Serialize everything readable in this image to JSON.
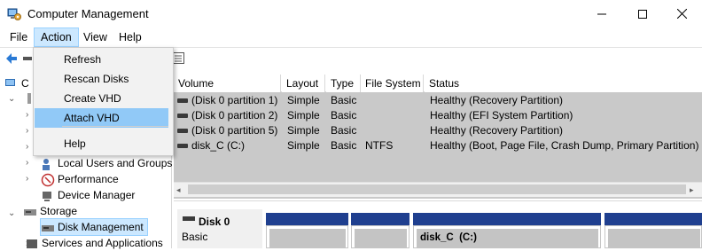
{
  "window": {
    "title": "Computer Management",
    "controls": {
      "minimize_icon": "minimize-icon",
      "maximize_icon": "maximize-icon",
      "close_icon": "close-icon"
    }
  },
  "menubar": {
    "items": [
      {
        "label": "File"
      },
      {
        "label": "Action"
      },
      {
        "label": "View"
      },
      {
        "label": "Help"
      }
    ],
    "open_menu": "Action"
  },
  "action_menu": {
    "items": [
      {
        "label": "Refresh"
      },
      {
        "label": "Rescan Disks"
      },
      {
        "label": "Create VHD"
      },
      {
        "label": "Attach VHD"
      },
      {
        "label": "Help"
      }
    ],
    "highlighted": "Attach VHD"
  },
  "tree": {
    "items": [
      {
        "label": "C"
      },
      {
        "label": "Local Users and Groups"
      },
      {
        "label": "Performance"
      },
      {
        "label": "Device Manager"
      },
      {
        "label": "Storage"
      },
      {
        "label": "Disk Management"
      },
      {
        "label": "Services and Applications"
      }
    ],
    "selected": "Disk Management"
  },
  "volume_table": {
    "columns": [
      "Volume",
      "Layout",
      "Type",
      "File System",
      "Status"
    ],
    "rows": [
      {
        "volume": "(Disk 0 partition 1)",
        "layout": "Simple",
        "type": "Basic",
        "fs": "",
        "status": "Healthy (Recovery Partition)"
      },
      {
        "volume": "(Disk 0 partition 2)",
        "layout": "Simple",
        "type": "Basic",
        "fs": "",
        "status": "Healthy (EFI System Partition)"
      },
      {
        "volume": "(Disk 0 partition 5)",
        "layout": "Simple",
        "type": "Basic",
        "fs": "",
        "status": "Healthy (Recovery Partition)"
      },
      {
        "volume": "disk_C (C:)",
        "layout": "Simple",
        "type": "Basic",
        "fs": "NTFS",
        "status": "Healthy (Boot, Page File, Crash Dump, Primary Partition)"
      }
    ]
  },
  "disk_view": {
    "disk_name": "Disk 0",
    "disk_type": "Basic",
    "partition_label": "disk_C  (C:)"
  },
  "colors": {
    "partition_bar": "#1f3f8f",
    "selection": "#cce8ff",
    "menu_highlight": "#91c9f7",
    "list_background": "#c9c9c9"
  }
}
